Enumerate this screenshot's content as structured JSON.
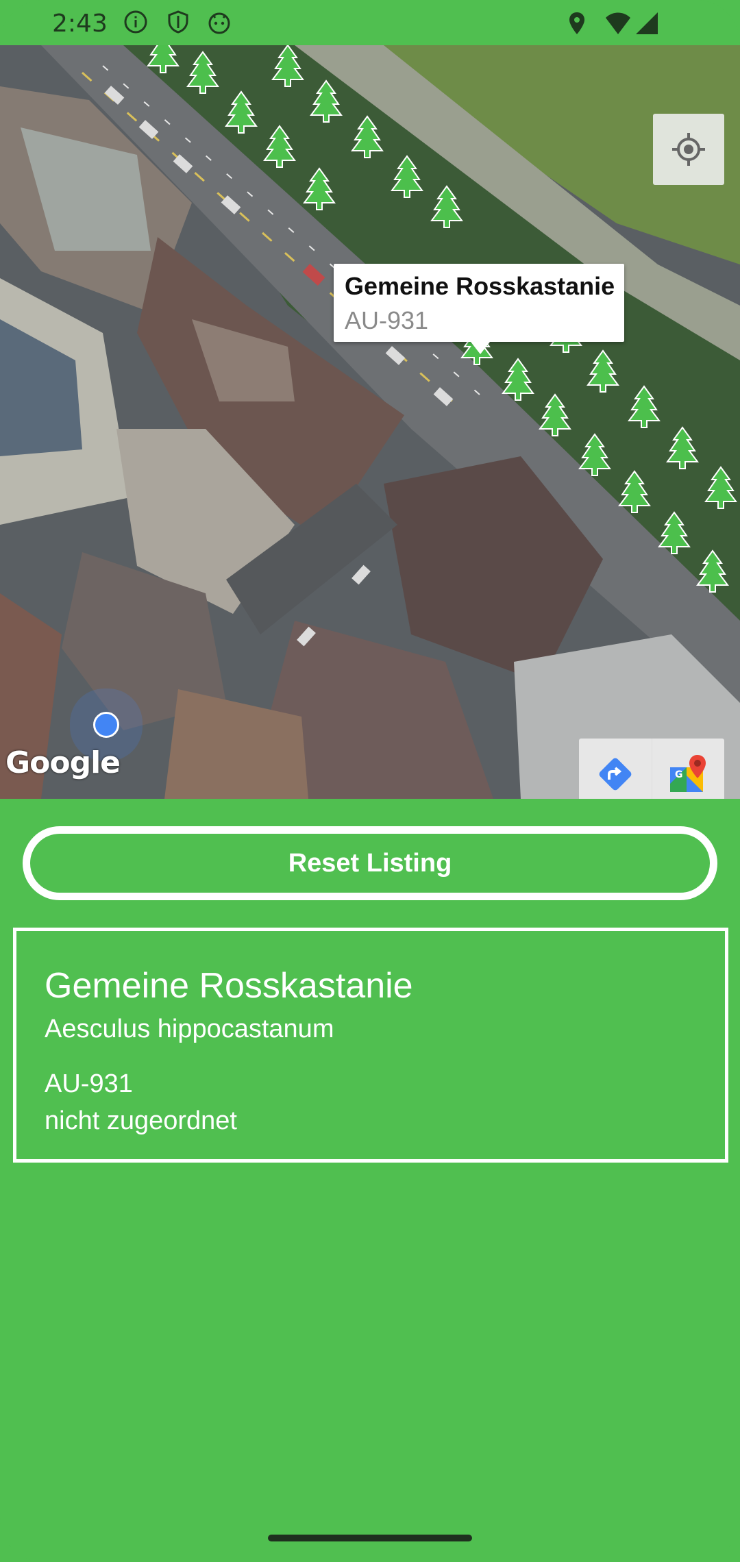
{
  "status_bar": {
    "time": "2:43",
    "left_icons": [
      "info-icon",
      "shield-icon",
      "android-face-icon"
    ],
    "right_icons": [
      "location-pin-icon",
      "wifi-icon",
      "signal-icon"
    ]
  },
  "map": {
    "info_window": {
      "title": "Gemeine Rosskastanie",
      "subtitle": "AU-931"
    },
    "attribution": "Google",
    "buttons": [
      "my-location-icon",
      "directions-icon",
      "google-maps-icon"
    ]
  },
  "reset_button": {
    "label": "Reset Listing"
  },
  "detail_card": {
    "name": "Gemeine Rosskastanie",
    "scientific_name": "Aesculus hippocastanum",
    "tree_id": "AU-931",
    "assignment": "nicht zugeordnet"
  },
  "colors": {
    "background": "#50BF50",
    "foreground": "#FFFFFF",
    "marker": "#4CBF4C",
    "location_dot": "#4285F4"
  }
}
